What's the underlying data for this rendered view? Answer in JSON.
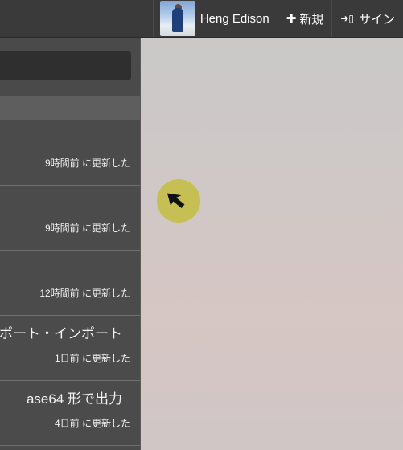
{
  "header": {
    "user_name": "Heng Edison",
    "new_label": "新規",
    "signin_label": "サイン"
  },
  "sidebar": {
    "items": [
      {
        "title": "",
        "updated": "9時間前 に更新した"
      },
      {
        "title": "",
        "updated": "9時間前 に更新した"
      },
      {
        "title": "",
        "updated": "12時間前 に更新した"
      },
      {
        "title": "ポート・インポート",
        "updated": "1日前 に更新した"
      },
      {
        "title": "ase64 形で出力",
        "updated": "4日前 に更新した"
      }
    ]
  },
  "icons": {
    "new": "plus-icon",
    "signin": "signin-icon",
    "cursor": "mouse-pointer-icon"
  },
  "colors": {
    "topbar": "#3a3a3a",
    "sidebar": "#4b4b4b",
    "cursor_highlight": "#c4be46"
  }
}
